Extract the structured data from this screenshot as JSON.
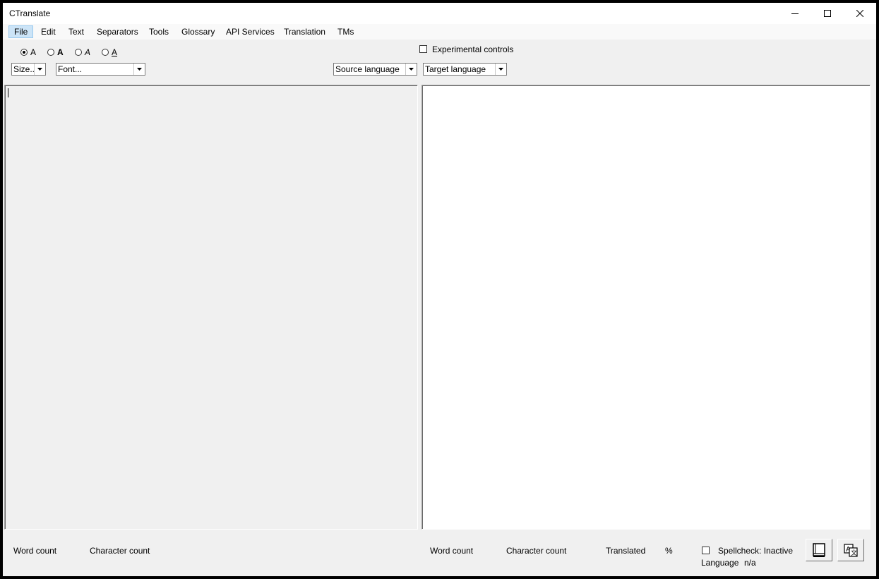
{
  "window": {
    "title": "CTranslate"
  },
  "menu": [
    "File",
    "Edit",
    "Text",
    "Separators",
    "Tools",
    "Glossary",
    "API Services",
    "Translation",
    "TMs"
  ],
  "toolbar": {
    "style_options": [
      {
        "label": "A",
        "style": "normal",
        "checked": true
      },
      {
        "label": "A",
        "style": "bold",
        "checked": false
      },
      {
        "label": "A",
        "style": "italic",
        "checked": false
      },
      {
        "label": "A",
        "style": "underline",
        "checked": false
      }
    ],
    "experimental_controls_label": "Experimental controls",
    "experimental_controls_checked": false,
    "size_combo": "Size...",
    "font_combo": "Font...",
    "source_language": "Source language",
    "target_language": "Target language"
  },
  "status": {
    "left_word_count": "Word count",
    "left_char_count": "Character count",
    "right_word_count": "Word count",
    "right_char_count": "Character count",
    "translated": "Translated",
    "percent": "%",
    "spellcheck": "Spellcheck: Inactive",
    "spellcheck_checked": false,
    "language_label": "Language",
    "language_value": "n/a"
  },
  "icons": {
    "glossary_button": "book-icon",
    "translate_button": "translate-icon"
  }
}
